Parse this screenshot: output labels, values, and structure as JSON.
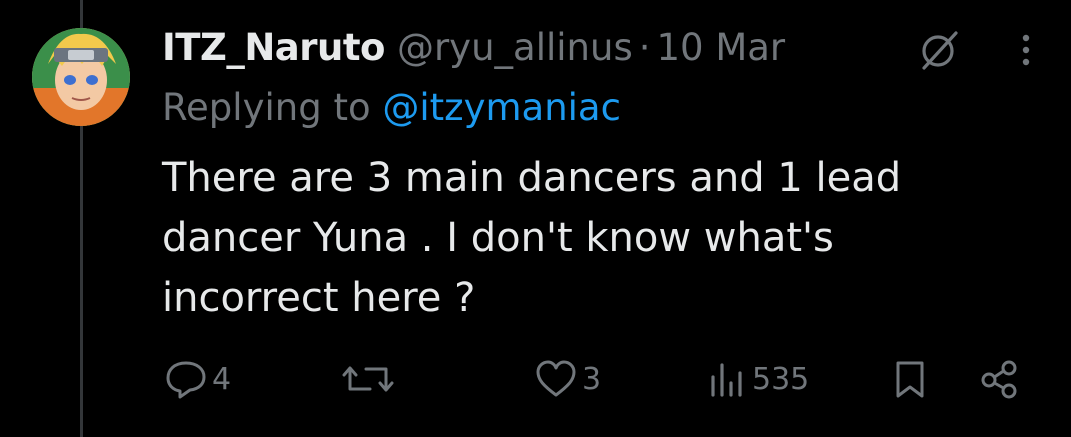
{
  "tweet": {
    "display_name": "ITZ_Naruto",
    "handle": "@ryu_allinus",
    "separator": "·",
    "date": "10 Mar",
    "replying_prefix": "Replying to",
    "replying_to": "@itzymaniac",
    "text": "There are 3 main dancers and 1 lead dancer Yuna . I don't know what's incorrect here ?"
  },
  "actions": {
    "reply_count": "4",
    "like_count": "3",
    "views_count": "535"
  },
  "icons": {
    "reply": "reply-icon",
    "retweet": "retweet-icon",
    "like": "heart-icon",
    "views": "views-icon",
    "bookmark": "bookmark-icon",
    "share": "share-icon",
    "grok": "grok-icon",
    "more": "more-icon"
  },
  "colors": {
    "background": "#000000",
    "primary_text": "#e7e9ea",
    "secondary_text": "#71767b",
    "link": "#1d9bf0"
  }
}
